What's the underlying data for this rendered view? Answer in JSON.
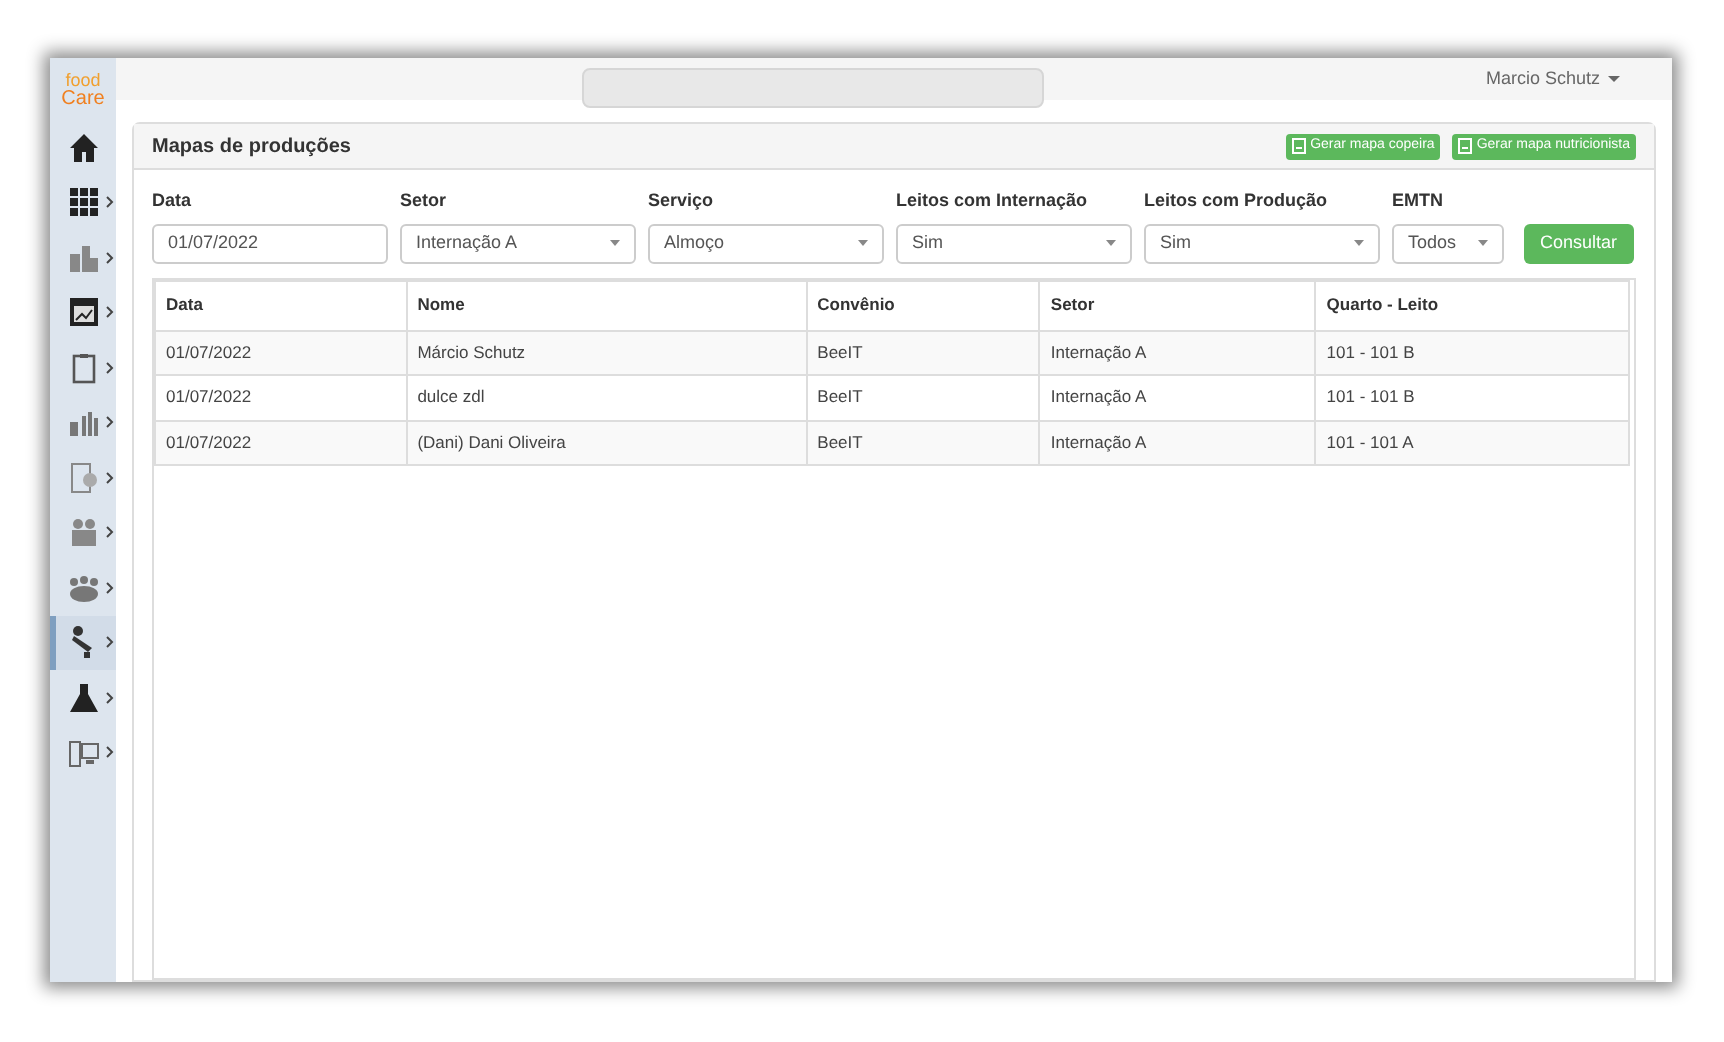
{
  "logo": {
    "line_1": "food",
    "line_2": "Care"
  },
  "sidebar": {
    "items": [
      {
        "selected": false,
        "submenu": false
      },
      {
        "selected": false,
        "submenu": true
      },
      {
        "selected": false,
        "submenu": true
      },
      {
        "selected": false,
        "submenu": true
      },
      {
        "selected": false,
        "submenu": true
      },
      {
        "selected": false,
        "submenu": true
      },
      {
        "selected": false,
        "submenu": true
      },
      {
        "selected": false,
        "submenu": true
      },
      {
        "selected": false,
        "submenu": true
      },
      {
        "selected": true,
        "submenu": true
      },
      {
        "selected": false,
        "submenu": true
      },
      {
        "selected": false,
        "submenu": true
      }
    ]
  },
  "topbar": {
    "user": "Marcio Schutz"
  },
  "panel": {
    "title": "Mapas de produções",
    "actions": [
      "Gerar mapa copeira",
      "Gerar mapa nutricionista"
    ]
  },
  "filters": [
    {
      "kind": "text",
      "label": "Data",
      "value": "01/07/2022"
    },
    {
      "kind": "select",
      "label": "Setor",
      "value": "Internação A"
    },
    {
      "kind": "select",
      "label": "Serviço",
      "value": "Almoço"
    },
    {
      "kind": "select",
      "label": "Leitos com Internação",
      "value": "Sim"
    },
    {
      "kind": "select",
      "label": "Leitos com Produção",
      "value": "Sim"
    },
    {
      "kind": "select",
      "label": "EMTN",
      "value": "Todos"
    }
  ],
  "submit": "Consultar",
  "table": {
    "columns": [
      "Data",
      "Nome",
      "Convênio",
      "Setor",
      "Quarto - Leito"
    ],
    "rows": [
      [
        "01/07/2022",
        "Márcio Schutz",
        "BeeIT",
        "Internação A",
        "101 - 101 B"
      ],
      [
        "01/07/2022",
        "dulce zdl",
        "BeeIT",
        "Internação A",
        "101 - 101 B"
      ],
      [
        "01/07/2022",
        "(Dani) Dani Oliveira",
        "BeeIT",
        "Internação A",
        "101 - 101 A"
      ]
    ]
  }
}
